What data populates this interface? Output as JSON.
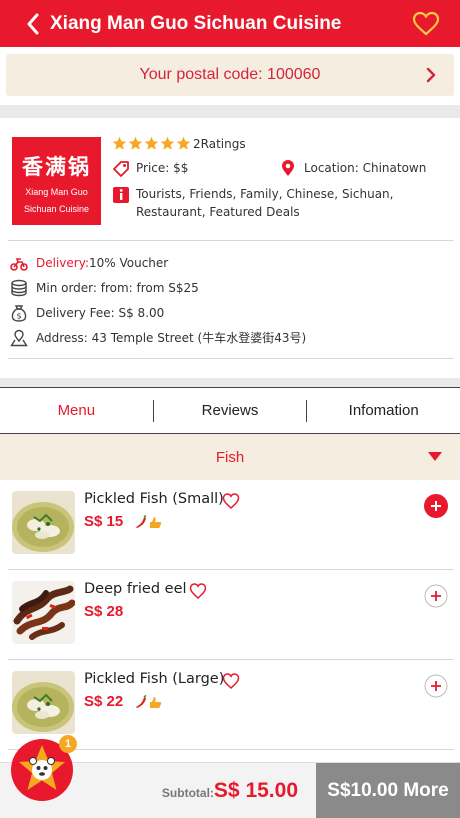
{
  "header": {
    "title": "Xiang Man Guo Sichuan Cuisine"
  },
  "postal": {
    "label": "Your postal code: 100060"
  },
  "restaurant": {
    "logo_cn": "香满锅",
    "logo_en_line1": "Xiang Man Guo",
    "logo_en_line2": "Sichuan Cuisine",
    "stars": 5,
    "ratings": "2Ratings",
    "price": "Price: $$",
    "location": "Location: Chinatown",
    "tags": "Tourists, Friends, Family, Chinese, Sichuan, Restaurant, Featured Deals",
    "delivery_label": "Delivery:",
    "delivery_value": "10% Voucher",
    "min_order": "Min order: from: from S$25",
    "delivery_fee": "Delivery Fee: S$ 8.00",
    "address": "Address: 43 Temple Street (牛车水登婆街43号)"
  },
  "tabs": [
    {
      "label": "Menu",
      "active": true
    },
    {
      "label": "Reviews",
      "active": false
    },
    {
      "label": "Infomation",
      "active": false
    }
  ],
  "category": {
    "label": "Fish"
  },
  "menu": [
    {
      "name": "Pickled Fish (Small)",
      "price": "S$ 15",
      "spicy": true,
      "added": true
    },
    {
      "name": "Deep fried eel",
      "price": "S$ 28",
      "spicy": false,
      "added": false
    },
    {
      "name": "Pickled Fish (Large)",
      "price": "S$ 22",
      "spicy": true,
      "added": false
    }
  ],
  "cart": {
    "badge": "1",
    "subtotal_label": "Subtotal:",
    "subtotal_value": "S$ 15.00",
    "more_label": "S$10.00 More"
  },
  "colors": {
    "accent": "#e8192c",
    "cream": "#f4ede0",
    "button_gray": "#8a8a8a",
    "badge": "#f5a623"
  }
}
